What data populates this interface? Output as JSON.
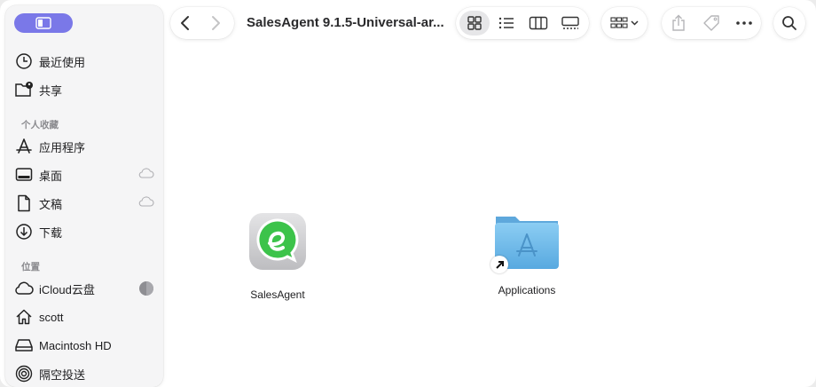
{
  "window": {
    "title": "SalesAgent 9.1.5-Universal-ar..."
  },
  "sidebar": {
    "recents_label": "最近使用",
    "shared_label": "共享",
    "favorites_header": "个人收藏",
    "favorites": [
      {
        "label": "应用程序",
        "icon": "applications-icon"
      },
      {
        "label": "桌面",
        "icon": "desktop-icon",
        "icloud": true
      },
      {
        "label": "文稿",
        "icon": "documents-icon",
        "icloud": true
      },
      {
        "label": "下载",
        "icon": "downloads-icon"
      }
    ],
    "locations_header": "位置",
    "locations": [
      {
        "label": "iCloud云盘",
        "icon": "icloud-icon",
        "progress": true
      },
      {
        "label": "scott",
        "icon": "home-icon"
      },
      {
        "label": "Macintosh HD",
        "icon": "disk-icon"
      },
      {
        "label": "隔空投送",
        "icon": "airdrop-icon"
      }
    ]
  },
  "toolbar": {
    "view_modes": [
      "icon-view",
      "list-view",
      "column-view",
      "gallery-view"
    ],
    "active_view": "icon-view"
  },
  "content": {
    "files": [
      {
        "name": "SalesAgent",
        "type": "app",
        "icon": "salesagent-app-icon",
        "accent": "#3cc34a"
      },
      {
        "name": "Applications",
        "type": "alias-folder",
        "icon": "applications-folder-icon",
        "accent": "#63b4e8"
      }
    ]
  },
  "colors": {
    "sidebar_toggle": "#7a78e8",
    "sidebar_bg": "#f5f5f6"
  }
}
